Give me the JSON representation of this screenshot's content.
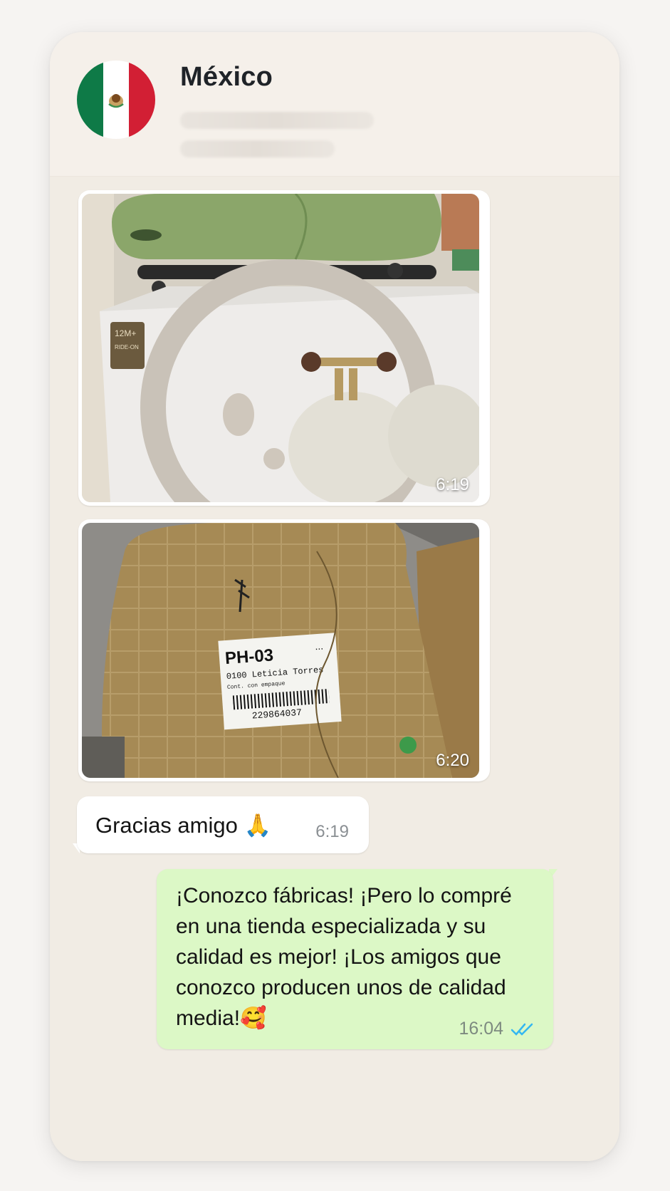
{
  "header": {
    "contact_name": "México",
    "avatar": "mexico-flag-avatar"
  },
  "messages": [
    {
      "type": "image",
      "direction": "incoming",
      "description": "ride-on toy boxes",
      "time": "6:19"
    },
    {
      "type": "image",
      "direction": "incoming",
      "description": "wrapped parcel with shipping label",
      "time": "6:20",
      "label": {
        "code": "PH-03",
        "dots": "...",
        "line1": "0100 Leticia Torres",
        "line2": "Cont. con empaque",
        "tracking": "229864037"
      }
    },
    {
      "type": "text",
      "direction": "incoming",
      "text": "Gracias amigo 🙏",
      "time": "6:19"
    },
    {
      "type": "text",
      "direction": "outgoing",
      "text": "¡Conozco fábricas!  ¡Pero lo compré en una tienda especializada y su calidad es mejor!  ¡Los amigos que conozco producen unos de calidad media!🥰",
      "time": "16:04",
      "status": "read-double-check"
    }
  ],
  "box_print": {
    "age": "12M+",
    "type": "RIDE-ON"
  },
  "colors": {
    "outgoing_bubble": "#dcf8c6",
    "incoming_bubble": "#ffffff",
    "read_ticks": "#34b7f1"
  }
}
